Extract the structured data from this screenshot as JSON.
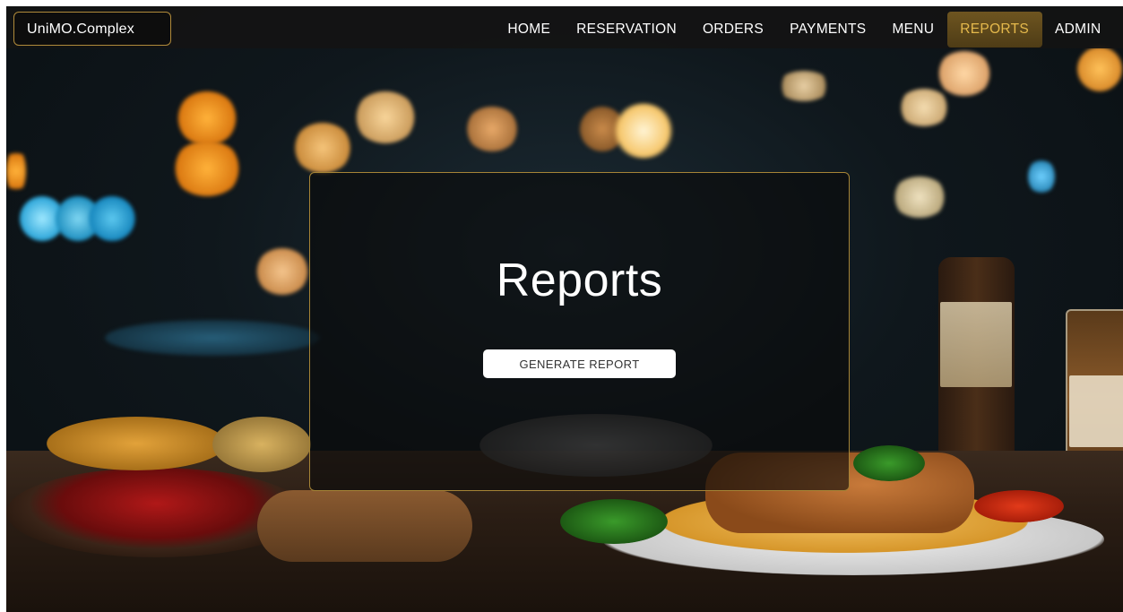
{
  "brand": {
    "name": "UniMO.Complex"
  },
  "nav": {
    "items": [
      {
        "label": "HOME"
      },
      {
        "label": "RESERVATION"
      },
      {
        "label": "ORDERS"
      },
      {
        "label": "PAYMENTS"
      },
      {
        "label": "MENU"
      },
      {
        "label": "REPORTS",
        "active": true
      },
      {
        "label": "ADMIN"
      }
    ]
  },
  "card": {
    "title": "Reports",
    "button_label": "GENERATE REPORT"
  },
  "colors": {
    "accent_gold": "#e5b94c",
    "card_border": "#a68436",
    "nav_background": "#141414"
  },
  "background": {
    "image": "restaurant-table-bokeh"
  }
}
